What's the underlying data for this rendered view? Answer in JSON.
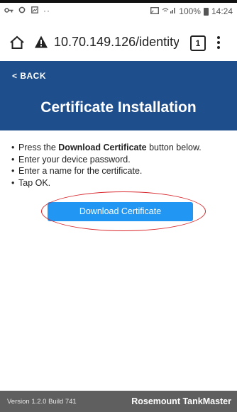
{
  "status_bar": {
    "left_icons": [
      "key-icon",
      "circle-icon",
      "image-icon"
    ],
    "left_dots": "··",
    "right_icons": [
      "cast-icon",
      "wifi-signal-icon"
    ],
    "battery": "100%",
    "time": "14:24"
  },
  "browser": {
    "url": "10.70.149.126/identity/",
    "tab_count": "1"
  },
  "header": {
    "back_label": "< BACK",
    "title": "Certificate Installation",
    "background": "#1f4e8c"
  },
  "instructions": [
    {
      "before": "Press the ",
      "bold": "Download Certificate",
      "after": " button below."
    },
    {
      "text": "Enter your device password."
    },
    {
      "text": "Enter a name for the certificate."
    },
    {
      "text": "Tap OK."
    }
  ],
  "download_button": {
    "label": "Download Certificate",
    "color": "#2196f3"
  },
  "annotation": {
    "color": "#d8262b"
  },
  "footer": {
    "version": "Version 1.2.0 Build 741",
    "brand": "Rosemount TankMaster",
    "background": "#5f5f5f"
  }
}
